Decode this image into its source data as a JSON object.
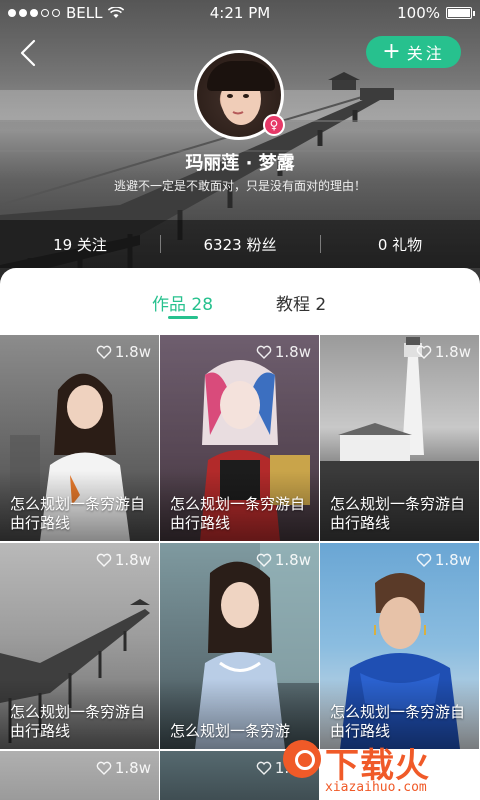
{
  "status_bar": {
    "carrier": "BELL",
    "time": "4:21 PM",
    "battery": "100%"
  },
  "header": {
    "follow_label": "关注",
    "user_name": "玛丽莲 · 梦露",
    "bio": "逃避不一定是不敢面对，只是没有面对的理由！"
  },
  "stats": [
    {
      "label": "19 关注"
    },
    {
      "label": "6323 粉丝"
    },
    {
      "label": "0 礼物"
    }
  ],
  "tabs": [
    {
      "label": "作品 28"
    },
    {
      "label": "教程 2"
    }
  ],
  "cards": [
    {
      "likes": "1.8w",
      "caption": "怎么规划一条穷游自由行路线",
      "theme": "portrait-outdoor"
    },
    {
      "likes": "1.8w",
      "caption": "怎么规划一条穷游自由行路线",
      "theme": "harley"
    },
    {
      "likes": "1.8w",
      "caption": "怎么规划一条穷游自由行路线",
      "theme": "lighthouse"
    },
    {
      "likes": "1.8w",
      "caption": "怎么规划一条穷游自由行路线",
      "theme": "pier"
    },
    {
      "likes": "1.8w",
      "caption": "怎么规划一条穷游",
      "theme": "portrait-window"
    },
    {
      "likes": "1.8w",
      "caption": "怎么规划一条穷游自由行路线",
      "theme": "blue-jacket"
    },
    {
      "likes": "1.8w",
      "caption": "",
      "theme": "pier"
    },
    {
      "likes": "1.8w",
      "caption": "",
      "theme": "portrait-window"
    }
  ],
  "watermark": {
    "text": "下载火",
    "url": "xiazaihuo.com"
  },
  "colors": {
    "accent": "#27c18e",
    "gender_badge": "#e63968",
    "watermark": "#f05a28"
  },
  "icons": {
    "back": "chevron-left-icon",
    "follow": "plus-icon",
    "gender": "female-icon",
    "like": "heart-outline-icon"
  }
}
